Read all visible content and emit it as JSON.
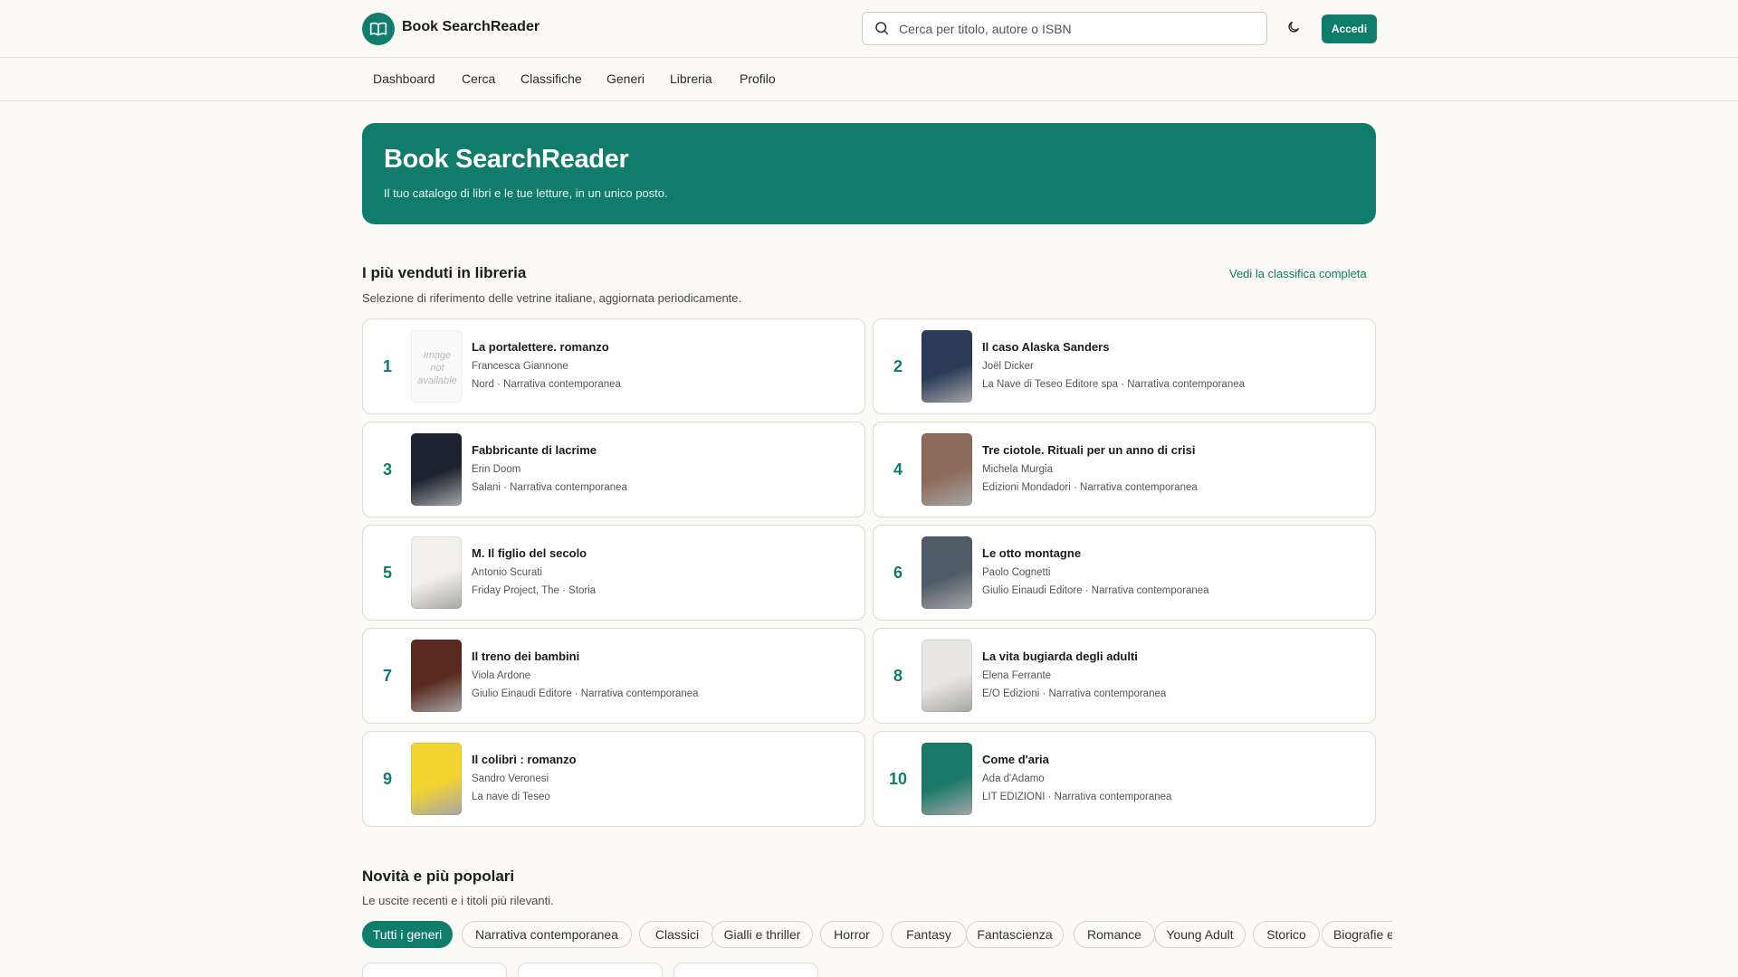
{
  "header": {
    "brand": "Book SearchReader",
    "search_placeholder": "Cerca per titolo, autore o ISBN",
    "login_label": "Accedi"
  },
  "nav": [
    "Dashboard",
    "Cerca",
    "Classifiche",
    "Generi",
    "Libreria",
    "Profilo"
  ],
  "hero": {
    "title": "Book SearchReader",
    "subtitle": "Il tuo catalogo di libri e le tue letture, in un unico posto."
  },
  "bestsellers": {
    "title": "I più venduti in libreria",
    "subtitle": "Selezione di riferimento delle vetrine italiane, aggiornata periodicamente.",
    "see_all": "Vedi la classifica completa",
    "placeholder_cover": "Image not available",
    "books": [
      {
        "rank": "1",
        "title": "La portalettere. romanzo",
        "author": "Francesca Giannone",
        "meta": "Nord · Narrativa contemporanea",
        "cover": "none"
      },
      {
        "rank": "2",
        "title": "Il caso Alaska Sanders",
        "author": "Joël Dicker",
        "meta": "La Nave di Teseo Editore spa · Narrativa contemporanea",
        "cover": "#2a3b57"
      },
      {
        "rank": "3",
        "title": "Fabbricante di lacrime",
        "author": "Erin Doom",
        "meta": "Salani · Narrativa contemporanea",
        "cover": "#1b2430"
      },
      {
        "rank": "4",
        "title": "Tre ciotole. Rituali per un anno di crisi",
        "author": "Michela Murgia",
        "meta": "Edizioni Mondadori · Narrativa contemporanea",
        "cover": "#8d6b5a"
      },
      {
        "rank": "5",
        "title": "M. Il figlio del secolo",
        "author": "Antonio Scurati",
        "meta": "Friday Project, The · Storia",
        "cover": "#f2f0ea"
      },
      {
        "rank": "6",
        "title": "Le otto montagne",
        "author": "Paolo Cognetti",
        "meta": "Giulio Einaudi Editore · Narrativa contemporanea",
        "cover": "#4f5c68"
      },
      {
        "rank": "7",
        "title": "Il treno dei bambini",
        "author": "Viola Ardone",
        "meta": "Giulio Einaudi Editore · Narrativa contemporanea",
        "cover": "#5a2a1e"
      },
      {
        "rank": "8",
        "title": "La vita bugiarda degli adulti",
        "author": "Elena Ferrante",
        "meta": "E/O Edizioni · Narrativa contemporanea",
        "cover": "#e9e7e3"
      },
      {
        "rank": "9",
        "title": "Il colibrì : romanzo",
        "author": "Sandro Veronesi",
        "meta": "La nave di Teseo",
        "cover": "#f3d431"
      },
      {
        "rank": "10",
        "title": "Come d'aria",
        "author": "Ada d'Adamo",
        "meta": "LIT EDIZIONI · Narrativa contemporanea",
        "cover": "#1a7a6a"
      }
    ]
  },
  "popular": {
    "title": "Novità e più popolari",
    "subtitle": "Le uscite recenti e i titoli più rilevanti.",
    "genres": [
      "Tutti i generi",
      "Narrativa contemporanea",
      "Classici",
      "Gialli e thriller",
      "Horror",
      "Fantasy",
      "Fantascienza",
      "Romance",
      "Young Adult",
      "Storico",
      "Biografie e"
    ]
  },
  "colors": {
    "accent": "#0f7c6c",
    "background": "#fcfaf4"
  },
  "icons": [
    "book-logo-icon",
    "search-icon",
    "moon-icon"
  ]
}
